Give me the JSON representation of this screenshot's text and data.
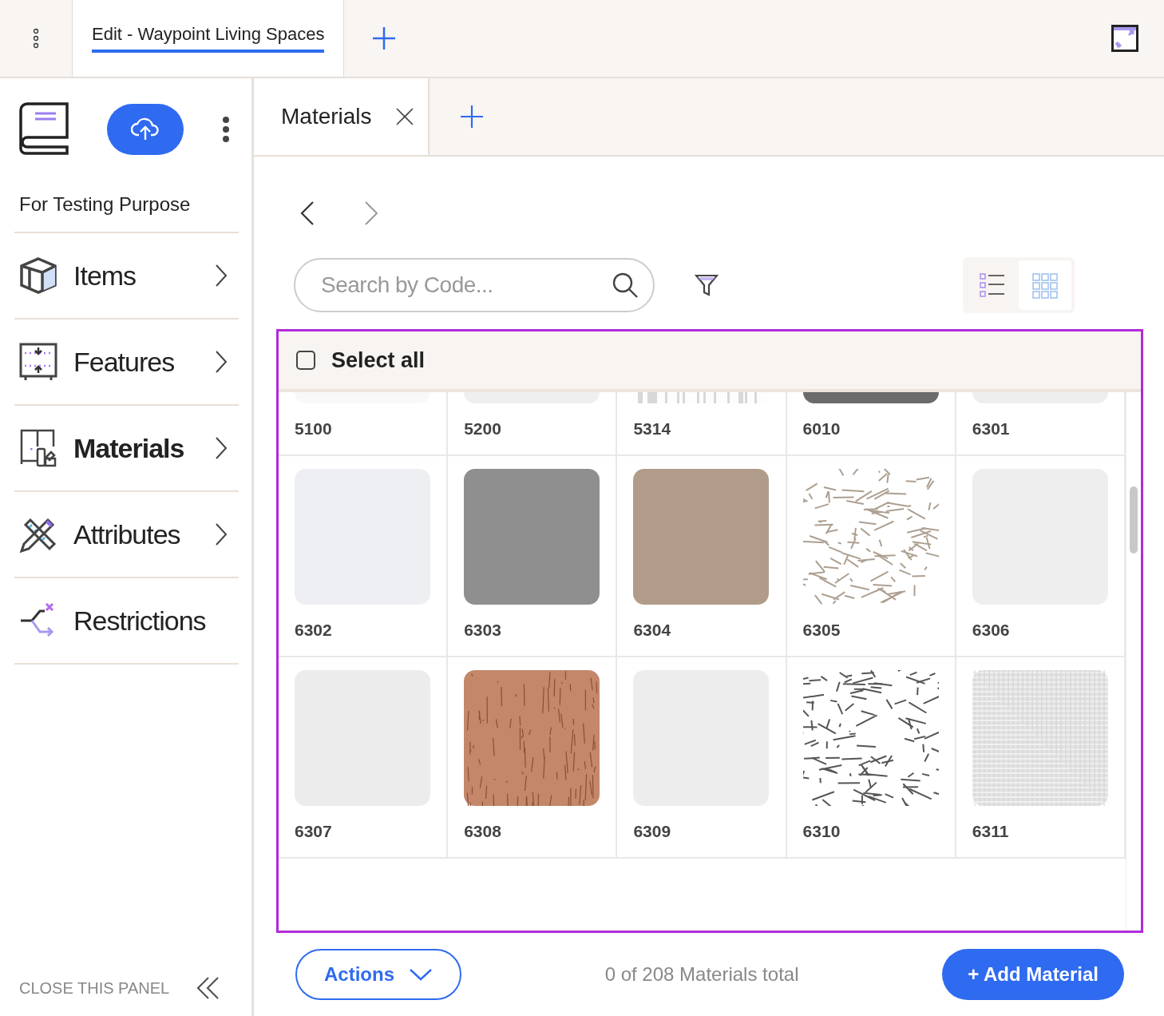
{
  "doc_tabs": [
    {
      "label": "Edit - Waypoint Living Spaces",
      "selected": true
    }
  ],
  "sidebar": {
    "title": "For Testing Purpose",
    "items": [
      {
        "label": "Items",
        "kind": "items",
        "selected": false,
        "has_arrow": true
      },
      {
        "label": "Features",
        "kind": "features",
        "selected": false,
        "has_arrow": true
      },
      {
        "label": "Materials",
        "kind": "materials",
        "selected": true,
        "has_arrow": true
      },
      {
        "label": "Attributes",
        "kind": "attributes",
        "selected": false,
        "has_arrow": true
      },
      {
        "label": "Restrictions",
        "kind": "restrictions",
        "selected": false,
        "has_arrow": false
      }
    ],
    "close_label": "CLOSE THIS PANEL"
  },
  "panel_tabs": [
    {
      "label": "Materials",
      "selected": true
    }
  ],
  "search": {
    "placeholder": "Search by Code..."
  },
  "views": [
    {
      "kind": "list",
      "selected": false
    },
    {
      "kind": "grid",
      "selected": true
    }
  ],
  "select_all": {
    "label": "Select all",
    "checked": false
  },
  "materials": [
    {
      "code": "5100",
      "kind": "solid",
      "color": "#f8f8f8"
    },
    {
      "code": "5200",
      "kind": "solid",
      "color": "#efefef"
    },
    {
      "code": "5314",
      "kind": "stripes",
      "color": "#d8d8d8"
    },
    {
      "code": "6010",
      "kind": "solid",
      "color": "#6b6b6b"
    },
    {
      "code": "6301",
      "kind": "solid",
      "color": "#eeeeee"
    },
    {
      "code": "6302",
      "kind": "solid",
      "color": "#eeeff3"
    },
    {
      "code": "6303",
      "kind": "solid",
      "color": "#8e8f8e"
    },
    {
      "code": "6304",
      "kind": "solid",
      "color": "#b09c88"
    },
    {
      "code": "6305",
      "kind": "mesh",
      "color": "#ad9f91"
    },
    {
      "code": "6306",
      "kind": "solid",
      "color": "#eeeeee"
    },
    {
      "code": "6307",
      "kind": "solid",
      "color": "#ececec"
    },
    {
      "code": "6308",
      "kind": "grain",
      "color": "#c4876a"
    },
    {
      "code": "6309",
      "kind": "solid",
      "color": "#ededed"
    },
    {
      "code": "6310",
      "kind": "mesh",
      "color": "#555555"
    },
    {
      "code": "6311",
      "kind": "fabric",
      "color": "#e2e2e2"
    }
  ],
  "footer": {
    "actions_label": "Actions",
    "total": "0 of 208 Materials total",
    "add_label": "+ Add Material"
  }
}
